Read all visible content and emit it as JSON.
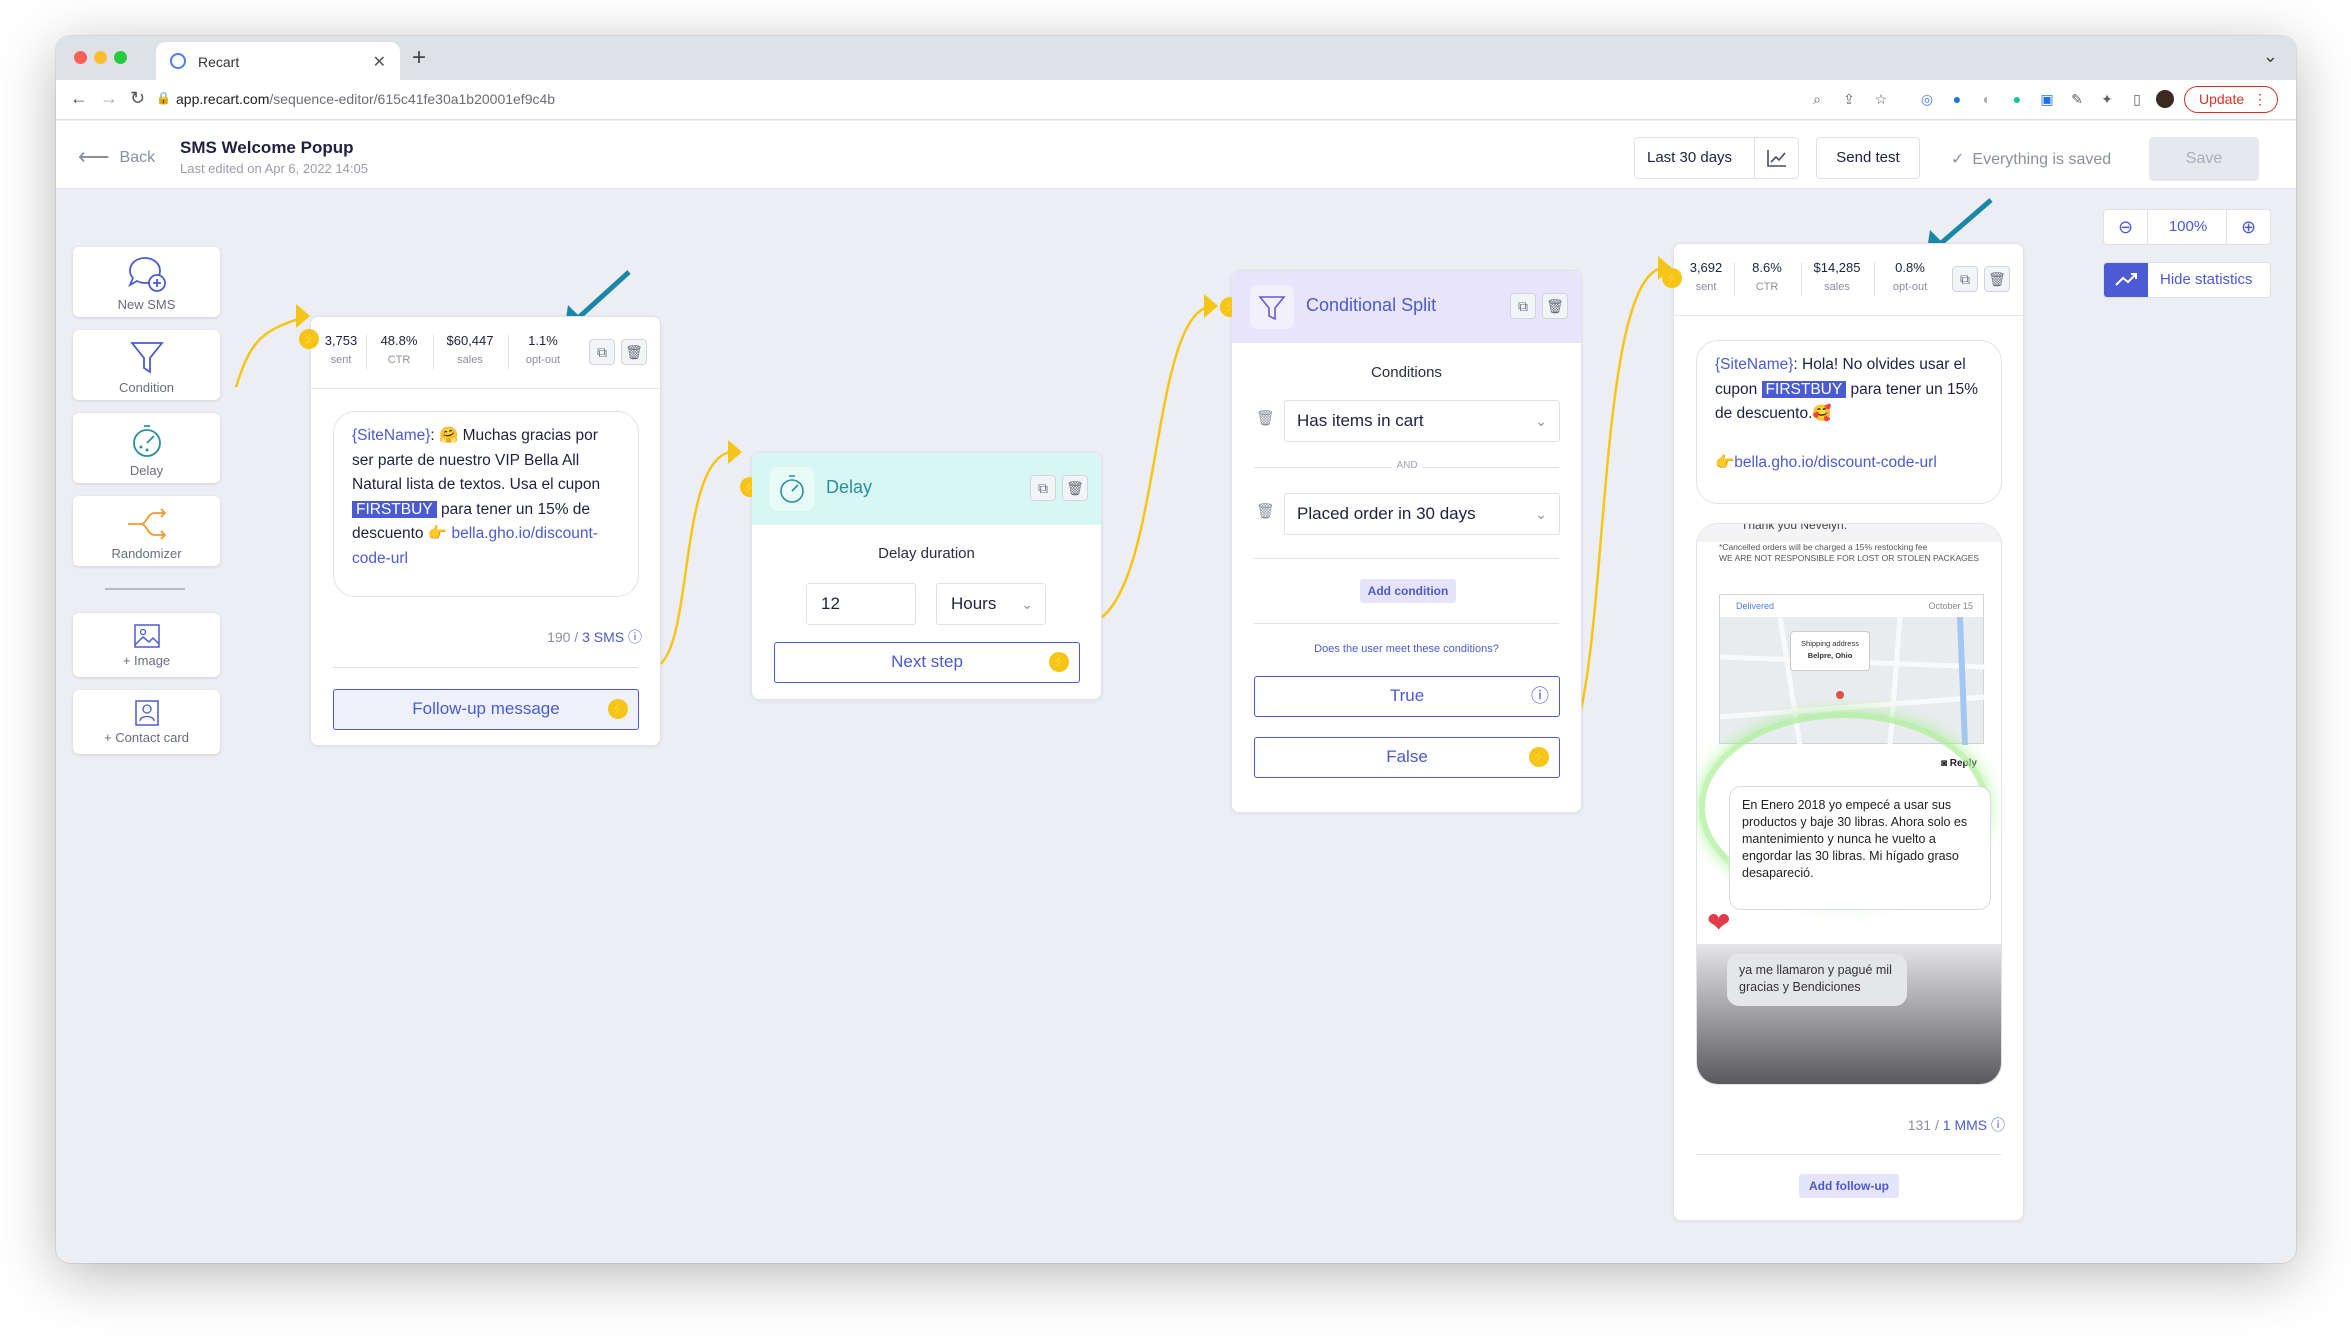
{
  "browser": {
    "tab_title": "Recart",
    "url_host": "app.recart.com",
    "url_path": "/sequence-editor/615c41fe30a1b20001ef9c4b",
    "update_label": "Update"
  },
  "header": {
    "back_label": "Back",
    "title": "SMS Welcome Popup",
    "subtitle": "Last edited on Apr 6, 2022 14:05",
    "range_label": "Last 30 days",
    "send_test_label": "Send test",
    "saved_label": "Everything is saved",
    "save_label": "Save"
  },
  "toolbox": {
    "new_sms": "New SMS",
    "condition": "Condition",
    "delay": "Delay",
    "randomizer": "Randomizer",
    "image": "+ Image",
    "contact_card": "+ Contact card"
  },
  "sms1": {
    "stats": [
      {
        "value": "3,753",
        "label": "sent"
      },
      {
        "value": "48.8%",
        "label": "CTR"
      },
      {
        "value": "$60,447",
        "label": "sales"
      },
      {
        "value": "1.1%",
        "label": "opt-out"
      }
    ],
    "var": "{SiteName}",
    "text_a": ": 🤗 Muchas gracias por ser parte de nuestro VIP Bella All Natural lista de textos. Usa el cupon ",
    "coupon": "FIRSTBUY",
    "text_b": " para tener un 15% de descuento 👉 ",
    "link": "bella.gho.io/discount-code-url",
    "count_prefix": "190 / ",
    "count_link": "3 SMS",
    "followup_label": "Follow-up message"
  },
  "delay": {
    "title": "Delay",
    "duration_label": "Delay duration",
    "amount": "12",
    "unit": "Hours",
    "next_label": "Next step"
  },
  "split": {
    "title": "Conditional Split",
    "conditions_label": "Conditions",
    "cond1": "Has items in cart",
    "and_label": "AND",
    "cond2": "Placed order in 30 days",
    "add_condition": "Add condition",
    "question": "Does the user meet these conditions?",
    "true_label": "True",
    "false_label": "False"
  },
  "sms2": {
    "stats": [
      {
        "value": "3,692",
        "label": "sent"
      },
      {
        "value": "8.6%",
        "label": "CTR"
      },
      {
        "value": "$14,285",
        "label": "sales"
      },
      {
        "value": "0.8%",
        "label": "opt-out"
      }
    ],
    "var": "{SiteName}",
    "text_a": ": Hola! No olvides usar el cupon ",
    "coupon": "FIRSTBUY",
    "text_b": " para tener un 15% de descuento.🥰",
    "link": "👉bella.gho.io/discount-code-url",
    "mms": {
      "top_text": "Thank you Nevelyn.",
      "notice1": "*Cancelled orders will be charged a 15% restocking fee",
      "notice2": "WE ARE NOT RESPONSIBLE FOR LOST OR STOLEN PACKAGES",
      "delivered": "Delivered",
      "date": "October 15",
      "ship_label": "Shipping address",
      "ship_city": "Belpre, Ohio",
      "reply": "Reply",
      "review": "En Enero 2018 yo empecé a usar sus productos y baje 30 libras. Ahora solo es mantenimiento y nunca he vuelto a engordar las 30 libras. Mi hígado graso desapareció.",
      "comment": "ya me llamaron y pagué mil gracias y Bendiciones"
    },
    "count_prefix": "131 / ",
    "count_link": "1 MMS",
    "add_followup": "Add follow-up"
  },
  "zoom": {
    "level": "100%"
  },
  "stats_toggle": {
    "label": "Hide statistics"
  },
  "colors": {
    "accent": "#4a5bd4",
    "connector": "#f5c518",
    "annotation_arrow": "#1b87a8"
  }
}
